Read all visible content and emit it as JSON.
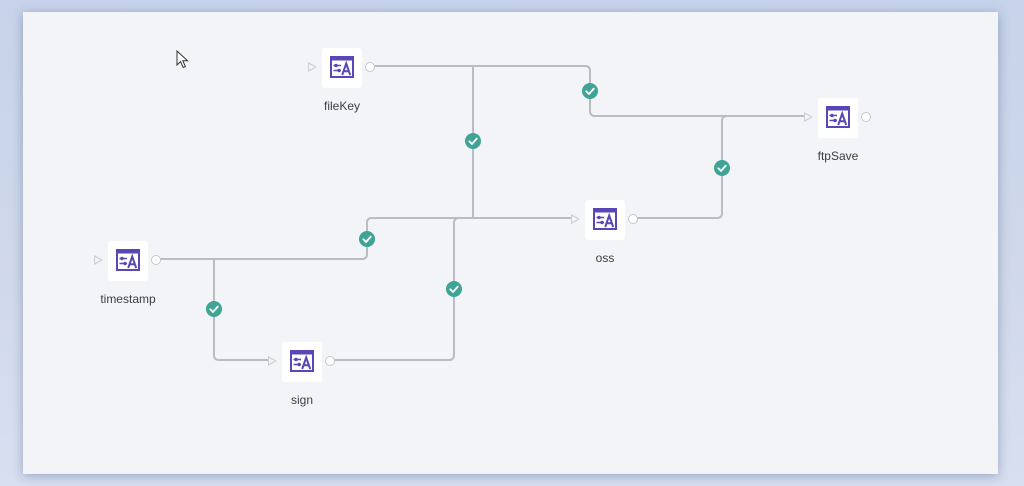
{
  "flow": {
    "nodes": [
      {
        "id": "fileKey",
        "label": "fileKey",
        "icon": "variable-assign-icon"
      },
      {
        "id": "ftpSave",
        "label": "ftpSave",
        "icon": "variable-assign-icon"
      },
      {
        "id": "oss",
        "label": "oss",
        "icon": "variable-assign-icon"
      },
      {
        "id": "timestamp",
        "label": "timestamp",
        "icon": "variable-assign-icon"
      },
      {
        "id": "sign",
        "label": "sign",
        "icon": "variable-assign-icon"
      }
    ],
    "connections": [
      {
        "from": "fileKey",
        "to": "ftpSave",
        "status": "success"
      },
      {
        "from": "fileKey",
        "to": "oss",
        "status": "success"
      },
      {
        "from": "oss",
        "to": "ftpSave",
        "status": "success"
      },
      {
        "from": "timestamp",
        "to": "oss",
        "status": "success"
      },
      {
        "from": "timestamp",
        "to": "sign",
        "status": "success"
      },
      {
        "from": "sign",
        "to": "oss",
        "status": "success"
      }
    ]
  },
  "colors": {
    "icon_accent": "#5a47b5",
    "success": "#3fa396",
    "connector": "#b9bcc2"
  }
}
